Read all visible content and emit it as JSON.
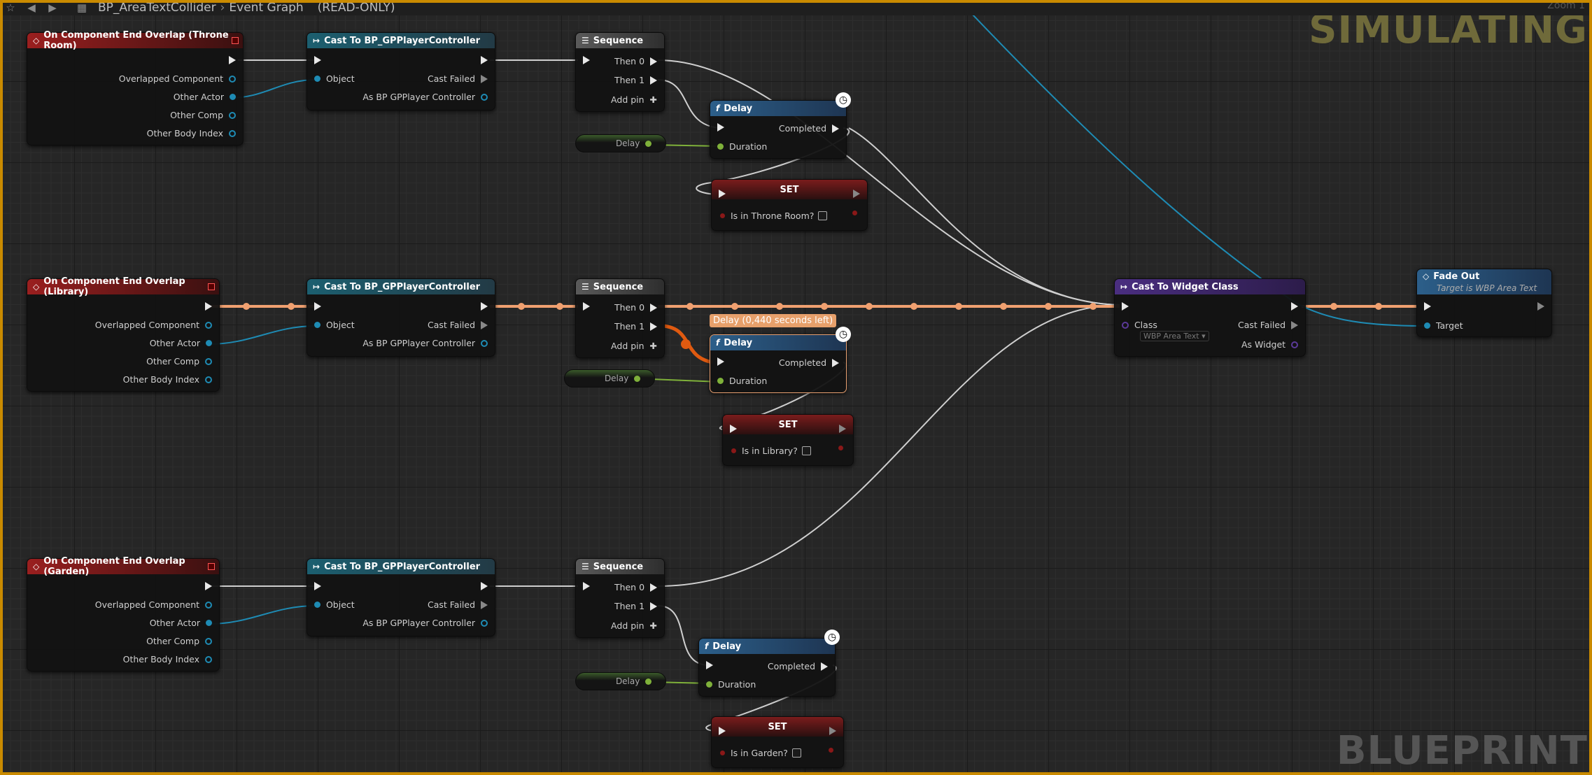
{
  "breadcrumb": {
    "asset": "BP_AreaTextCollider",
    "graph": "Event Graph",
    "mode": "(READ-ONLY)"
  },
  "toolbar": {
    "back_icon": "arrow-left-icon",
    "forward_icon": "arrow-right-icon",
    "zoom_label": "Zoom 1"
  },
  "watermarks": {
    "simulating": "SIMULATING",
    "blueprint": "BLUEPRINT"
  },
  "colors": {
    "exec_active": "#f0a070",
    "object_wire": "#1e8bb4",
    "float_wire": "#7fb13a",
    "frame": "#c98a00"
  },
  "events": [
    {
      "title": "On Component End Overlap (Throne Room)",
      "pins": [
        "Overlapped Component",
        "Other Actor",
        "Other Comp",
        "Other Body Index"
      ]
    },
    {
      "title": "On Component End Overlap (Library)",
      "pins": [
        "Overlapped Component",
        "Other Actor",
        "Other Comp",
        "Other Body Index"
      ]
    },
    {
      "title": "On Component End Overlap (Garden)",
      "pins": [
        "Overlapped Component",
        "Other Actor",
        "Other Comp",
        "Other Body Index"
      ]
    }
  ],
  "cast": {
    "title": "Cast To BP_GPPlayerController",
    "object": "Object",
    "failed": "Cast Failed",
    "as": "As BP GPPlayer Controller"
  },
  "sequence": {
    "title": "Sequence",
    "then0": "Then 0",
    "then1": "Then 1",
    "addpin": "Add pin"
  },
  "delay": {
    "title": "Delay",
    "completed": "Completed",
    "duration": "Duration",
    "var": "Delay",
    "tooltip": "Delay (0,440 seconds left)"
  },
  "sets": [
    {
      "title": "SET",
      "label": "Is in Throne Room?"
    },
    {
      "title": "SET",
      "label": "Is in Library?"
    },
    {
      "title": "SET",
      "label": "Is in Garden?"
    }
  ],
  "widget_cast": {
    "title": "Cast To Widget Class",
    "class": "Class",
    "class_value": "WBP Area Text",
    "failed": "Cast Failed",
    "as": "As Widget"
  },
  "fade": {
    "title": "Fade Out",
    "subtitle": "Target is WBP Area Text",
    "target": "Target"
  }
}
